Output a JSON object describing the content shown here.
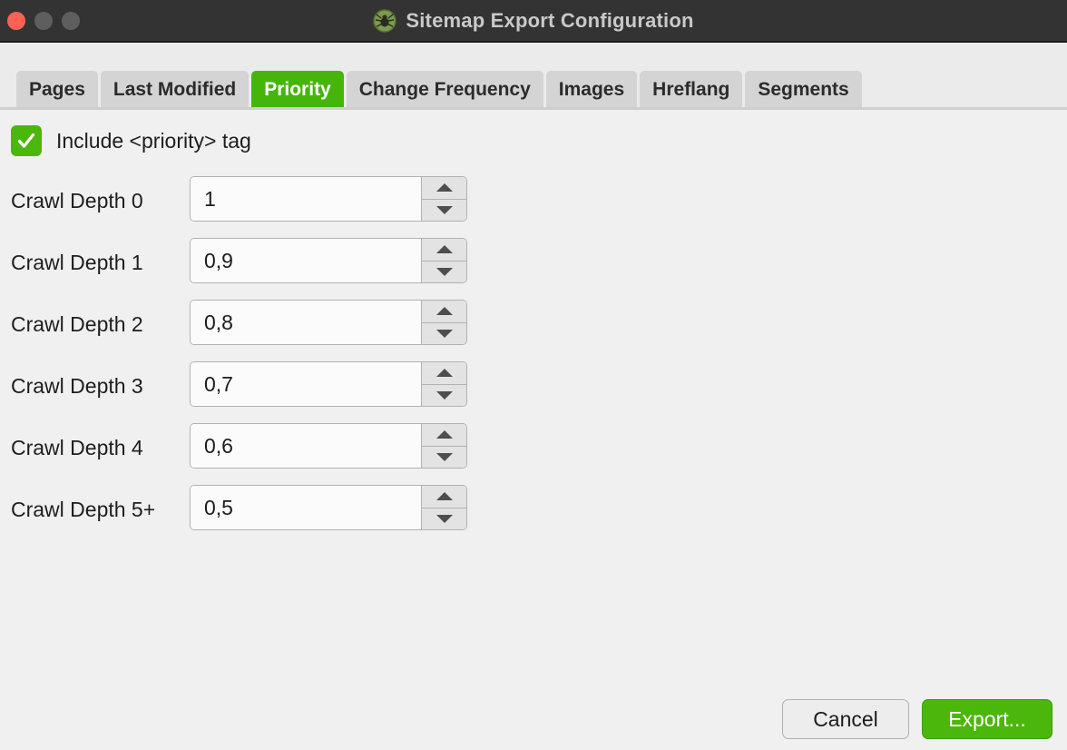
{
  "window": {
    "title": "Sitemap Export Configuration",
    "icon": "spider-logo-icon",
    "controls": {
      "close": "close-window-button",
      "minimize": "minimize-window-button",
      "maximize": "maximize-window-button"
    }
  },
  "tabs": [
    {
      "label": "Pages",
      "active": false
    },
    {
      "label": "Last Modified",
      "active": false
    },
    {
      "label": "Priority",
      "active": true
    },
    {
      "label": "Change Frequency",
      "active": false
    },
    {
      "label": "Images",
      "active": false
    },
    {
      "label": "Hreflang",
      "active": false
    },
    {
      "label": "Segments",
      "active": false
    }
  ],
  "include_option": {
    "label": "Include <priority> tag",
    "checked": true
  },
  "fields": [
    {
      "label": "Crawl Depth 0",
      "value": "1"
    },
    {
      "label": "Crawl Depth 1",
      "value": "0,9"
    },
    {
      "label": "Crawl Depth 2",
      "value": "0,8"
    },
    {
      "label": "Crawl Depth 3",
      "value": "0,7"
    },
    {
      "label": "Crawl Depth 4",
      "value": "0,6"
    },
    {
      "label": "Crawl Depth 5+",
      "value": "0,5"
    }
  ],
  "footer": {
    "cancel_label": "Cancel",
    "export_label": "Export..."
  },
  "colors": {
    "accent_green": "#4cb70b",
    "tab_active_green": "#45b609",
    "titlebar": "#333333",
    "background": "#f0f0f0",
    "tabstrip": "#ebebeb",
    "close_red": "#ff6155"
  }
}
